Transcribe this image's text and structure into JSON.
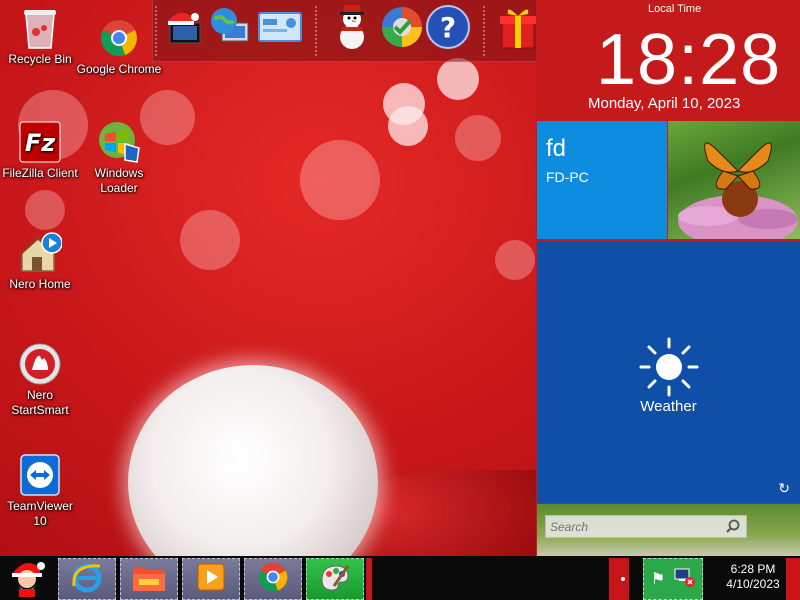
{
  "desktop": {
    "icons": [
      {
        "label": "Recycle Bin",
        "icon": "recycle-bin-icon"
      },
      {
        "label": "Google Chrome",
        "icon": "chrome-icon"
      },
      {
        "label": "FileZilla Client",
        "icon": "filezilla-icon"
      },
      {
        "label": "Windows Loader",
        "icon": "windows-loader-icon"
      },
      {
        "label": "Nero Home",
        "icon": "nero-home-icon"
      },
      {
        "label": "Nero StartSmart",
        "icon": "nero-startsmart-icon"
      },
      {
        "label": "TeamViewer 10",
        "icon": "teamviewer-icon"
      }
    ]
  },
  "dock": {
    "items": [
      "santa-computer-icon",
      "globe-network-icon",
      "control-panel-icon",
      "snowman-icon",
      "windows-update-icon",
      "help-icon",
      "gift-icon",
      "folder-icon",
      "trash-icon"
    ]
  },
  "metro": {
    "clock_label": "Local Time",
    "time": "18:28",
    "date": "Monday, April 10, 2023",
    "user_tile": {
      "name": "fd",
      "pc": "FD-PC"
    },
    "weather_tile": {
      "label": "Weather"
    },
    "search": {
      "placeholder": "Search"
    }
  },
  "taskbar": {
    "apps": [
      "santa-start-icon",
      "internet-explorer-icon",
      "folder-icon",
      "media-player-icon",
      "chrome-icon",
      "paint-icon"
    ],
    "clock_time": "6:28 PM",
    "clock_date": "4/10/2023"
  },
  "colors": {
    "wallpaper_red": "#c8171a",
    "metro_blue": "#0d8ce0",
    "weather_blue": "#0f4fa8",
    "active_green": "#1a9a2e"
  }
}
